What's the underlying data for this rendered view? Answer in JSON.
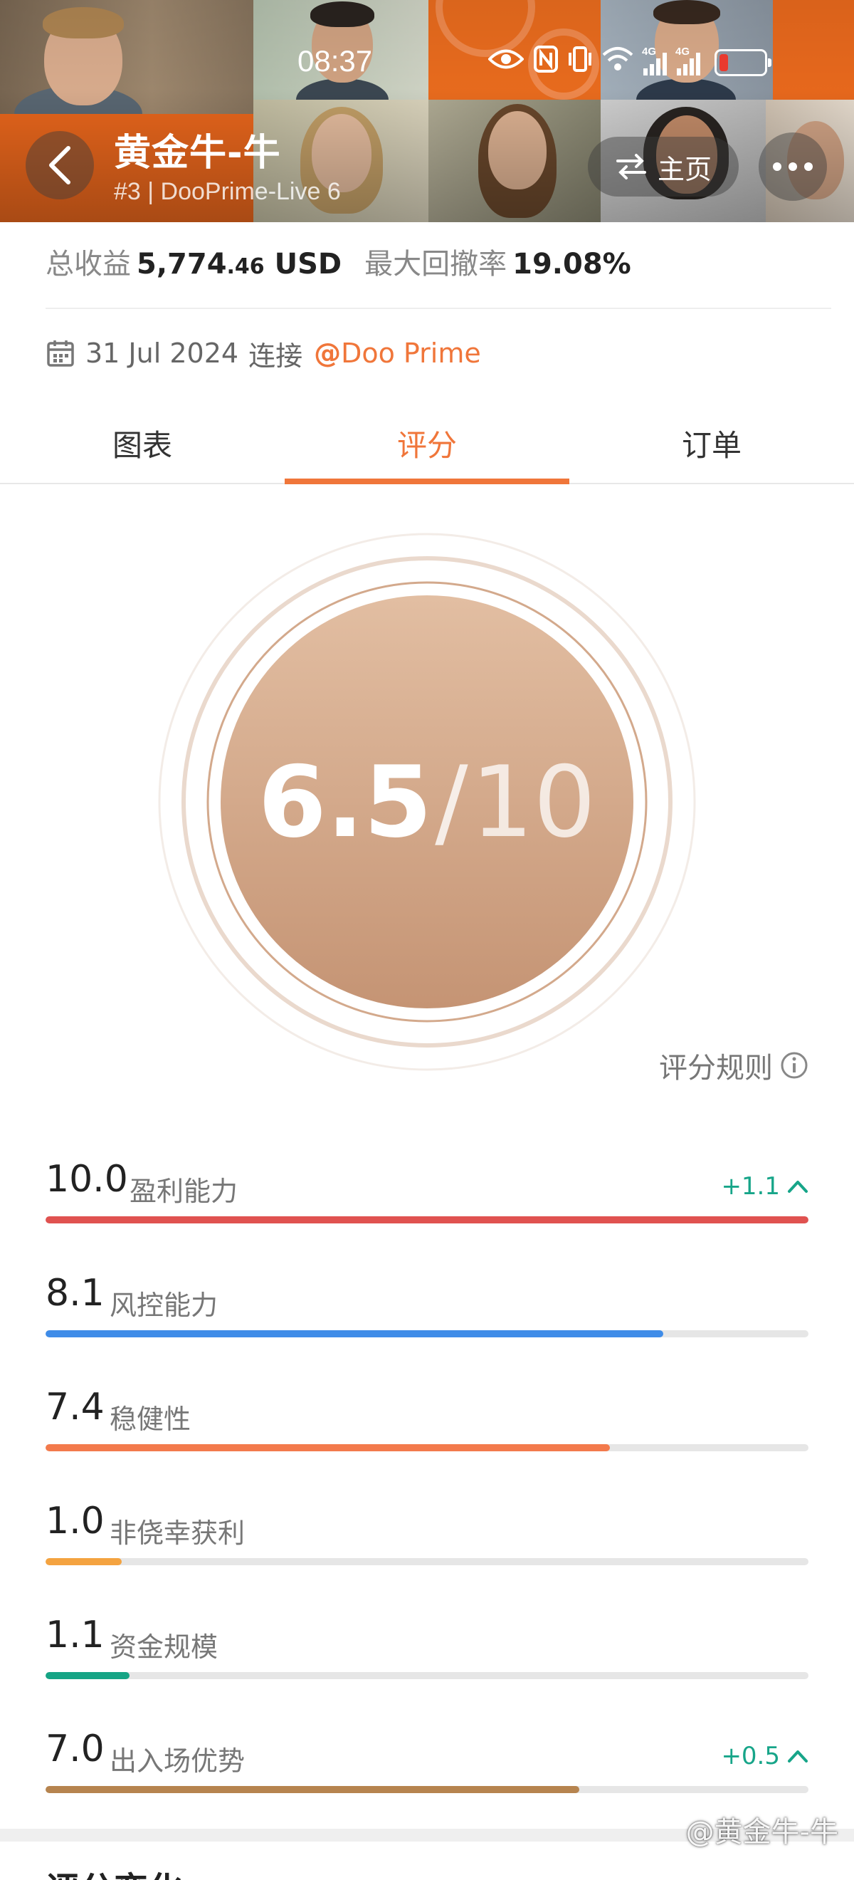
{
  "status_bar": {
    "time": "08:37",
    "network_1": "4G",
    "network_2": "4G"
  },
  "header": {
    "title": "黄金牛-牛",
    "subtitle": "#3 | DooPrime-Live 6",
    "home_label": "主页"
  },
  "stats": {
    "profit_label": "总收益",
    "profit_main": "5,774",
    "profit_decimals": ".46",
    "profit_currency": "USD",
    "drawdown_label": "最大回撤率",
    "drawdown_value": "19.08%"
  },
  "connection": {
    "date": "31 Jul 2024",
    "connect_label": "连接",
    "at": "@",
    "broker": "Doo Prime"
  },
  "tabs": [
    "图表",
    "评分",
    "订单"
  ],
  "active_tab": 1,
  "score": {
    "value": "6.5",
    "slash": "/",
    "max": "10",
    "fraction": 0.65
  },
  "rules_label": "评分规则",
  "metrics": [
    {
      "value": "10.0",
      "label": "盈利能力",
      "fraction": 1.0,
      "color": "#e05250",
      "delta": "+1.1"
    },
    {
      "value": "8.1",
      "label": "风控能力",
      "fraction": 0.81,
      "color": "#3f8ce8",
      "delta": ""
    },
    {
      "value": "7.4",
      "label": "稳健性",
      "fraction": 0.74,
      "color": "#f37a4c",
      "delta": ""
    },
    {
      "value": "1.0",
      "label": "非侥幸获利",
      "fraction": 0.1,
      "color": "#f4a340",
      "delta": ""
    },
    {
      "value": "1.1",
      "label": "资金规模",
      "fraction": 0.11,
      "color": "#16a485",
      "delta": ""
    },
    {
      "value": "7.0",
      "label": "出入场优势",
      "fraction": 0.7,
      "color": "#b6844f",
      "delta": "+0.5"
    }
  ],
  "next_section_title": "评分变化",
  "watermark": "@黄金牛-牛",
  "colors": {
    "accent": "#f0763a",
    "up": "#17a589",
    "score_top": "#e2bea2",
    "score_bottom": "#c79677"
  }
}
